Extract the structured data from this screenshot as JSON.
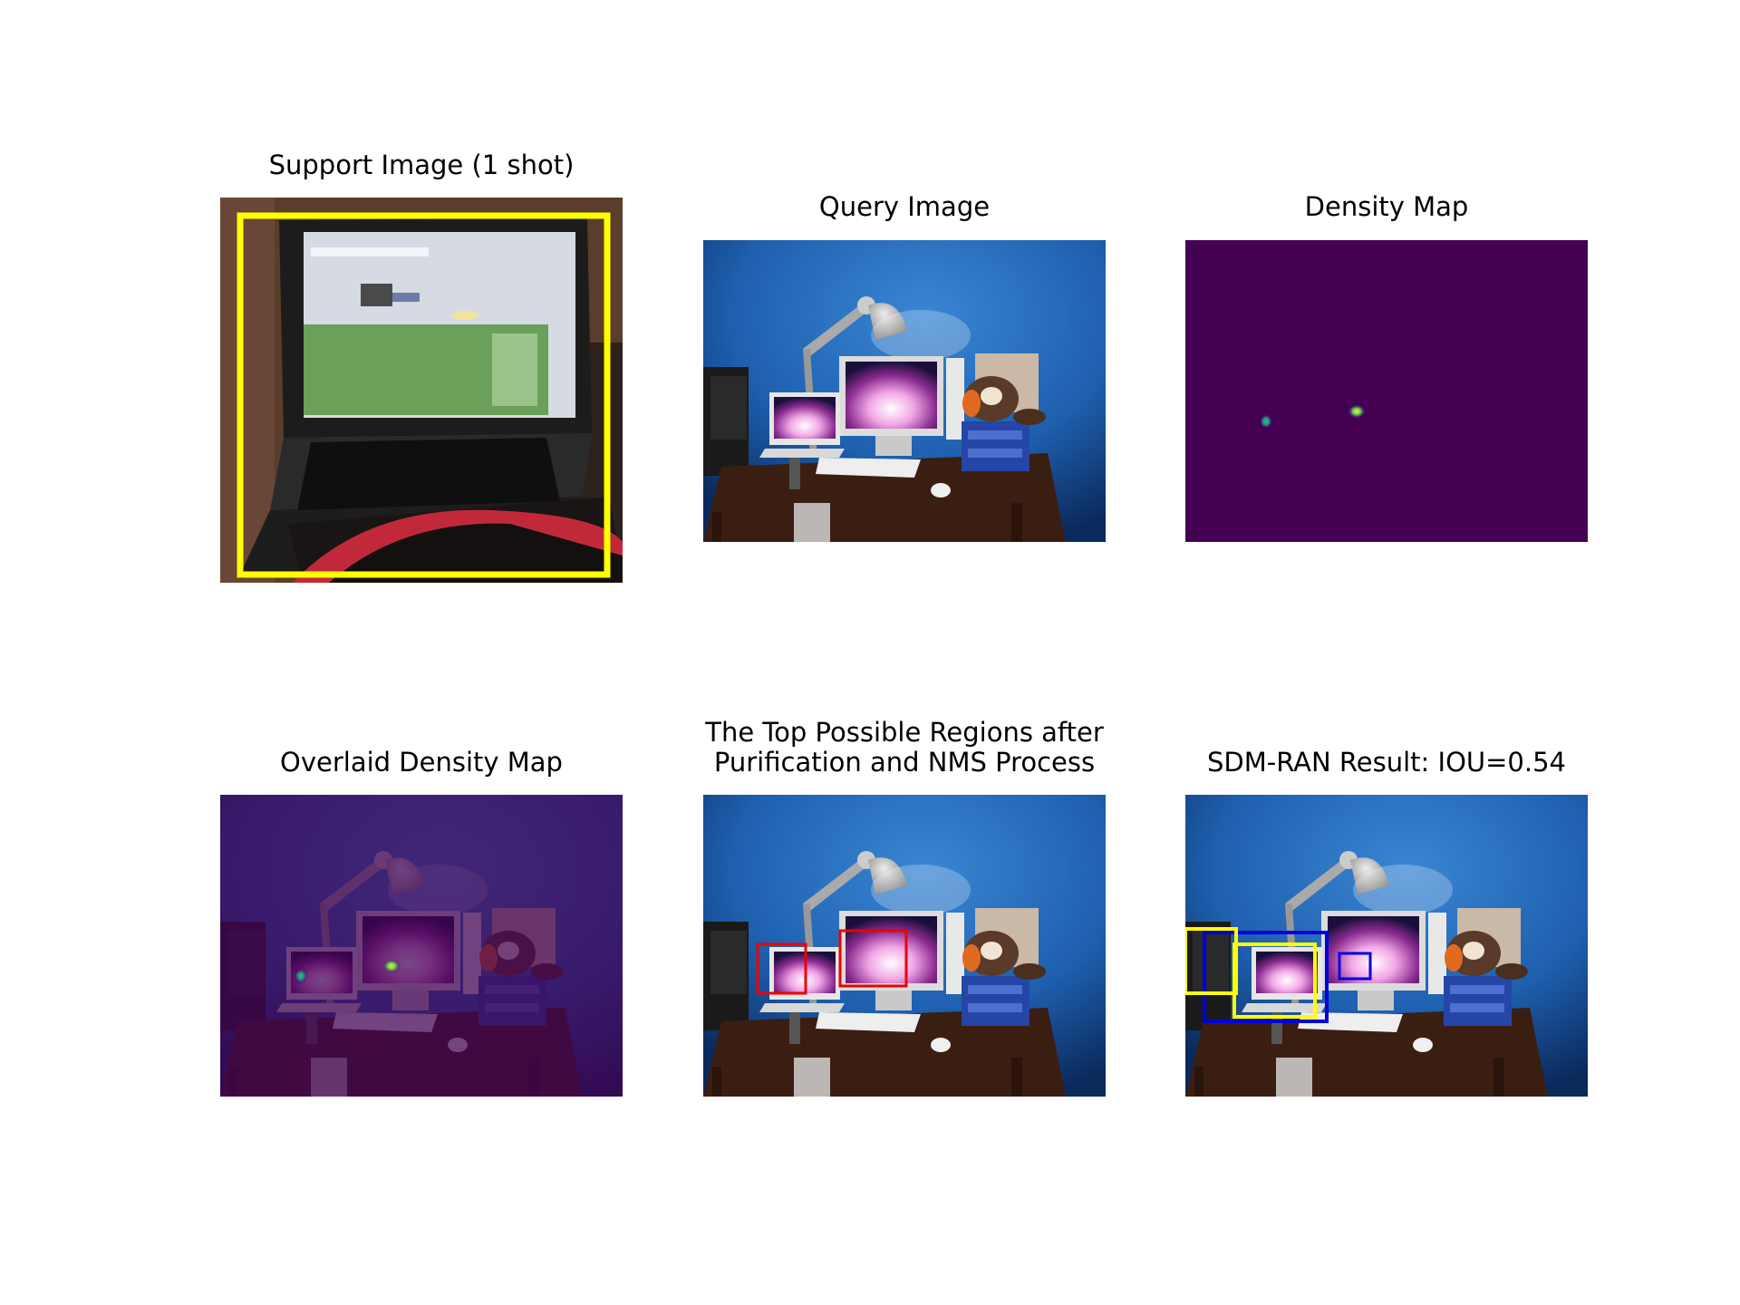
{
  "panels": {
    "support": {
      "title": "Support Image (1 shot)"
    },
    "query": {
      "title": "Query Image"
    },
    "density": {
      "title": "Density Map"
    },
    "overlay": {
      "title": "Overlaid Density Map"
    },
    "regions": {
      "title_line1": "The Top Possible Regions after",
      "title_line2": "Purification and NMS Process"
    },
    "result": {
      "title": "SDM-RAN Result: IOU=0.54"
    }
  },
  "colors": {
    "support_box": "#ffff00",
    "region_box": "#ee0000",
    "prediction_box": "#0000dd",
    "ground_truth_box": "#ffff00",
    "density_background": "#440154",
    "wall": "#1f5fa8",
    "desk": "#3b1e12"
  }
}
